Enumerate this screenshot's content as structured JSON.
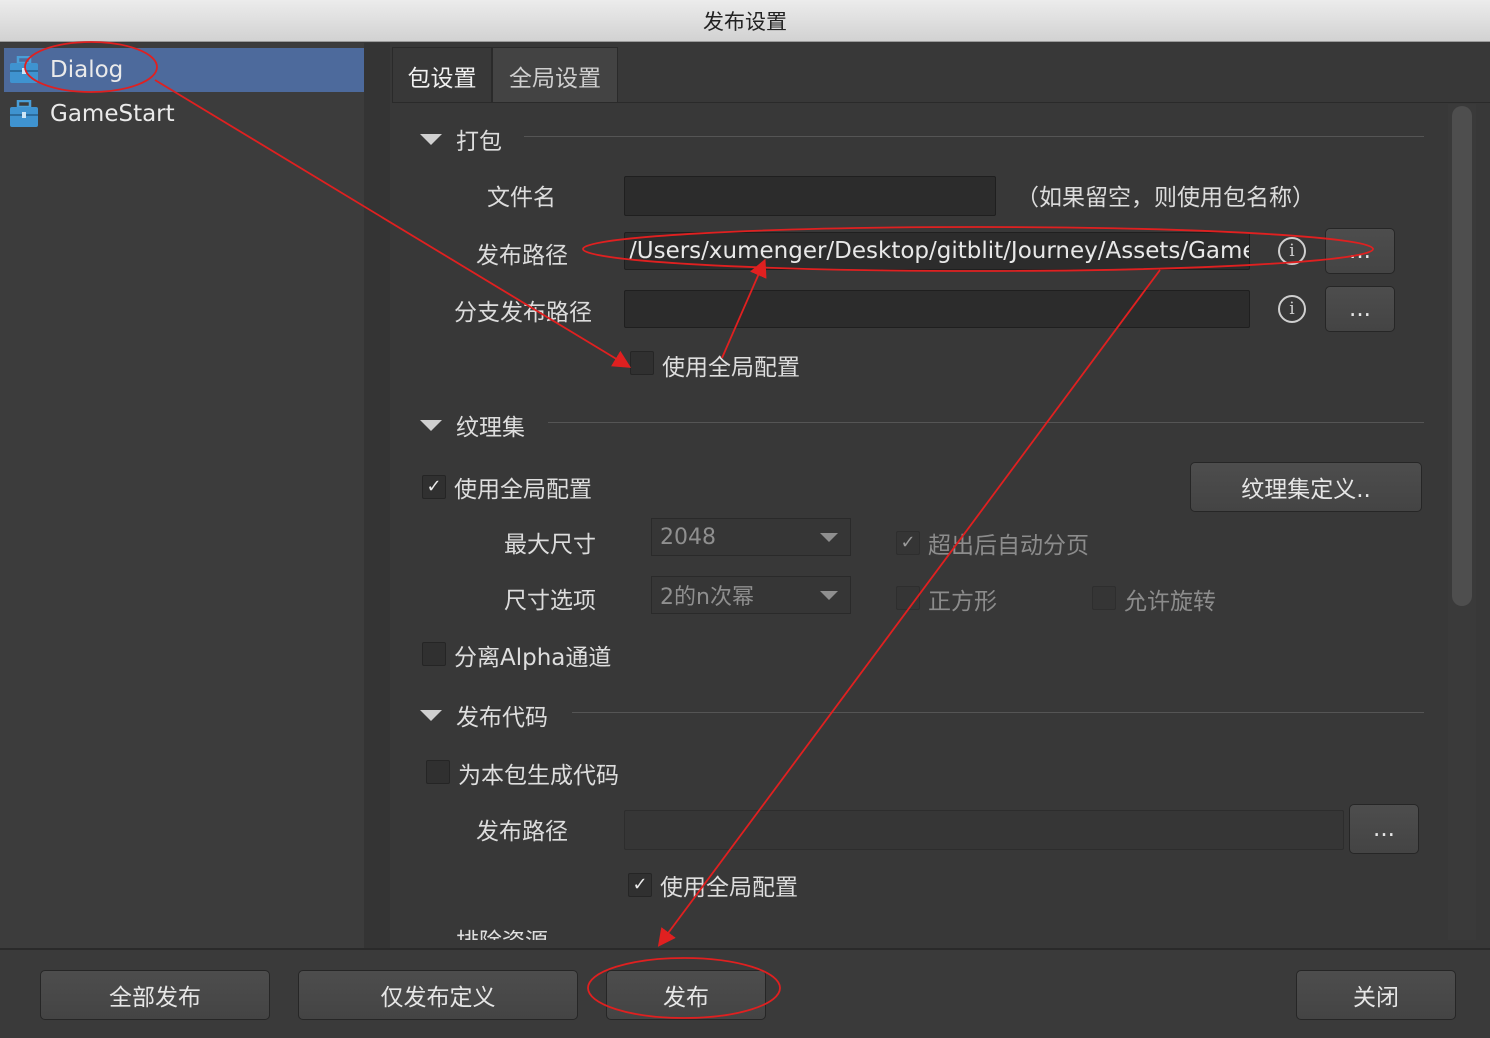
{
  "window": {
    "title": "发布设置"
  },
  "packages": [
    {
      "name": "Dialog",
      "icon": "package-icon",
      "selected": true
    },
    {
      "name": "GameStart",
      "icon": "package-icon",
      "selected": false
    }
  ],
  "tabs": [
    {
      "label": "包设置",
      "active": true
    },
    {
      "label": "全局设置",
      "active": false
    }
  ],
  "packaging": {
    "title": "打包",
    "file_name": {
      "label": "文件名",
      "value": "",
      "hint": "（如果留空，则使用包名称）"
    },
    "publish_path": {
      "label": "发布路径",
      "value": "/Users/xumenger/Desktop/gitblit/Journey/Assets/GameFra",
      "browse": "..."
    },
    "branch_path": {
      "label": "分支发布路径",
      "value": "",
      "browse": "..."
    },
    "use_global": {
      "label": "使用全局配置",
      "checked": false
    }
  },
  "atlas": {
    "title": "纹理集",
    "use_global": {
      "label": "使用全局配置",
      "checked": true
    },
    "define_button": "纹理集定义..",
    "max_size": {
      "label": "最大尺寸",
      "value": "2048"
    },
    "size_option": {
      "label": "尺寸选项",
      "value": "2的n次幂"
    },
    "auto_page": {
      "label": "超出后自动分页",
      "checked": true
    },
    "square": {
      "label": "正方形",
      "checked": false
    },
    "allow_rotate": {
      "label": "允许旋转",
      "checked": false
    },
    "separate_alpha": {
      "label": "分离Alpha通道",
      "checked": false
    }
  },
  "code": {
    "title": "发布代码",
    "gen_code": {
      "label": "为本包生成代码",
      "checked": false
    },
    "path": {
      "label": "发布路径",
      "value": "",
      "browse": "..."
    },
    "use_global": {
      "label": "使用全局配置",
      "checked": true
    },
    "exclude_partial": "排除资源"
  },
  "footer": {
    "publish_all": "全部发布",
    "publish_definition": "仅发布定义",
    "publish": "发布",
    "close": "关闭"
  },
  "colors": {
    "selection": "#4d6a9c",
    "annotation": "#e02020",
    "background": "#383838"
  },
  "icons": {
    "check": "✓",
    "info": "i"
  }
}
